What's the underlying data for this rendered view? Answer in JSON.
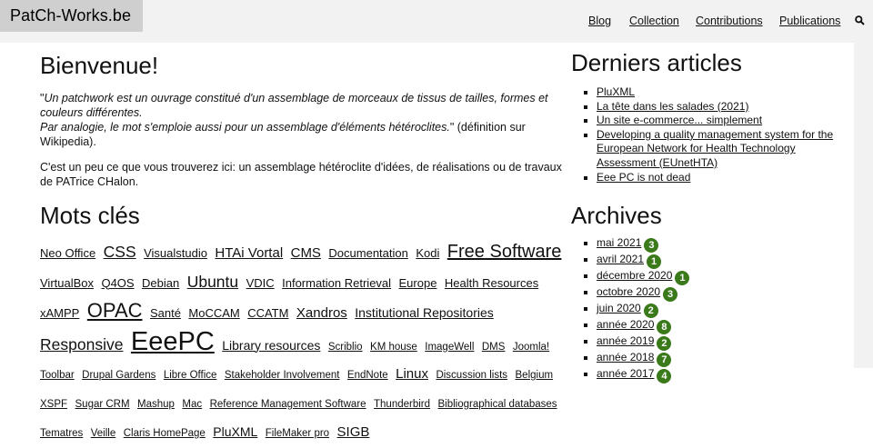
{
  "site": {
    "logo": "PatCh-Works.be"
  },
  "nav": {
    "items": [
      "Blog",
      "Collection",
      "Contributions",
      "Publications"
    ]
  },
  "main": {
    "title": "Bienvenue!",
    "quote_line1": "Un patchwork est un ouvrage constitué d'un assemblage de morceaux de tissus de tailles, formes et couleurs différentes.",
    "quote_line2": "Par analogie, le mot s'emploie aussi pour un assemblage d'éléments hétéroclites.",
    "quote_suffix": " (définition sur Wikipedia).",
    "intro": "C'est un peu ce que vous trouverez ici: un assemblage hétéroclite d'idées, de réalisations ou de travaux de PATrice CHalon.",
    "keywords_title": "Mots clés",
    "keywords": [
      {
        "label": "Neo Office",
        "size": 2
      },
      {
        "label": "CSS",
        "size": 5
      },
      {
        "label": "Visualstudio",
        "size": 2
      },
      {
        "label": "HTAi Vortal",
        "size": 4
      },
      {
        "label": "CMS",
        "size": 4
      },
      {
        "label": "Documentation",
        "size": 2
      },
      {
        "label": "Kodi",
        "size": 2
      },
      {
        "label": "Free Software",
        "size": 6
      },
      {
        "label": "VirtualBox",
        "size": 2
      },
      {
        "label": "Q4OS",
        "size": 2
      },
      {
        "label": "Debian",
        "size": 2
      },
      {
        "label": "Ubuntu",
        "size": 5
      },
      {
        "label": "VDIC",
        "size": 2
      },
      {
        "label": "Information Retrieval",
        "size": 2
      },
      {
        "label": "Europe",
        "size": 2
      },
      {
        "label": "Health Resources",
        "size": 2
      },
      {
        "label": "xAMPP",
        "size": 2
      },
      {
        "label": "OPAC",
        "size": 7
      },
      {
        "label": "Santé",
        "size": 2
      },
      {
        "label": "MoCCAM",
        "size": 2
      },
      {
        "label": "CCATM",
        "size": 2
      },
      {
        "label": "Xandros",
        "size": 4
      },
      {
        "label": "Institutional Repositories",
        "size": 3
      },
      {
        "label": "Responsive",
        "size": 5
      },
      {
        "label": "EeePC",
        "size": 8
      },
      {
        "label": "Library resources",
        "size": 3
      },
      {
        "label": "Scriblio",
        "size": 1
      },
      {
        "label": "KM house",
        "size": 1
      },
      {
        "label": "ImageWell",
        "size": 1
      },
      {
        "label": "DMS",
        "size": 1
      },
      {
        "label": "Joomla!",
        "size": 1
      },
      {
        "label": "Toolbar",
        "size": 1
      },
      {
        "label": "Drupal Gardens",
        "size": 1
      },
      {
        "label": "Libre Office",
        "size": 1
      },
      {
        "label": "Stakeholder Involvement",
        "size": 1
      },
      {
        "label": "EndNote",
        "size": 1
      },
      {
        "label": "Linux",
        "size": 4
      },
      {
        "label": "Discussion lists",
        "size": 1
      },
      {
        "label": "Belgium",
        "size": 1
      },
      {
        "label": "XSPF",
        "size": 1
      },
      {
        "label": "Sugar CRM",
        "size": 1
      },
      {
        "label": "Mashup",
        "size": 1
      },
      {
        "label": "Mac",
        "size": 1
      },
      {
        "label": "Reference Management Software",
        "size": 1
      },
      {
        "label": "Thunderbird",
        "size": 1
      },
      {
        "label": "Bibliographical databases",
        "size": 1
      },
      {
        "label": "Tematres",
        "size": 1
      },
      {
        "label": "Veille",
        "size": 1
      },
      {
        "label": "Claris HomePage",
        "size": 1
      },
      {
        "label": "PluXML",
        "size": 3
      },
      {
        "label": "FileMaker pro",
        "size": 1
      },
      {
        "label": "SIGB",
        "size": 4
      }
    ]
  },
  "sidebar": {
    "articles_title": "Derniers articles",
    "articles": [
      "PluXML",
      "La tête dans les salades (2021)",
      "Un site e-commerce... simplement",
      "Developing a quality management system for the European Network for Health Technology Assessment (EUnetHTA)",
      "Eee PC is not dead"
    ],
    "archives_title": "Archives",
    "archives": [
      {
        "label": "mai 2021",
        "count": "3"
      },
      {
        "label": "avril 2021",
        "count": "1"
      },
      {
        "label": "décembre 2020",
        "count": "1"
      },
      {
        "label": "octobre 2020",
        "count": "3"
      },
      {
        "label": "juin 2020",
        "count": "2"
      },
      {
        "label": "année 2020",
        "count": "8"
      },
      {
        "label": "année 2019",
        "count": "2"
      },
      {
        "label": "année 2018",
        "count": "7"
      },
      {
        "label": "année 2017",
        "count": "4"
      }
    ]
  },
  "colors": {
    "badge": "#3a7a1a",
    "header_bg": "#f2f2f2",
    "logo_bg": "#cfcfcf"
  },
  "icons": {
    "search": "search-icon"
  }
}
